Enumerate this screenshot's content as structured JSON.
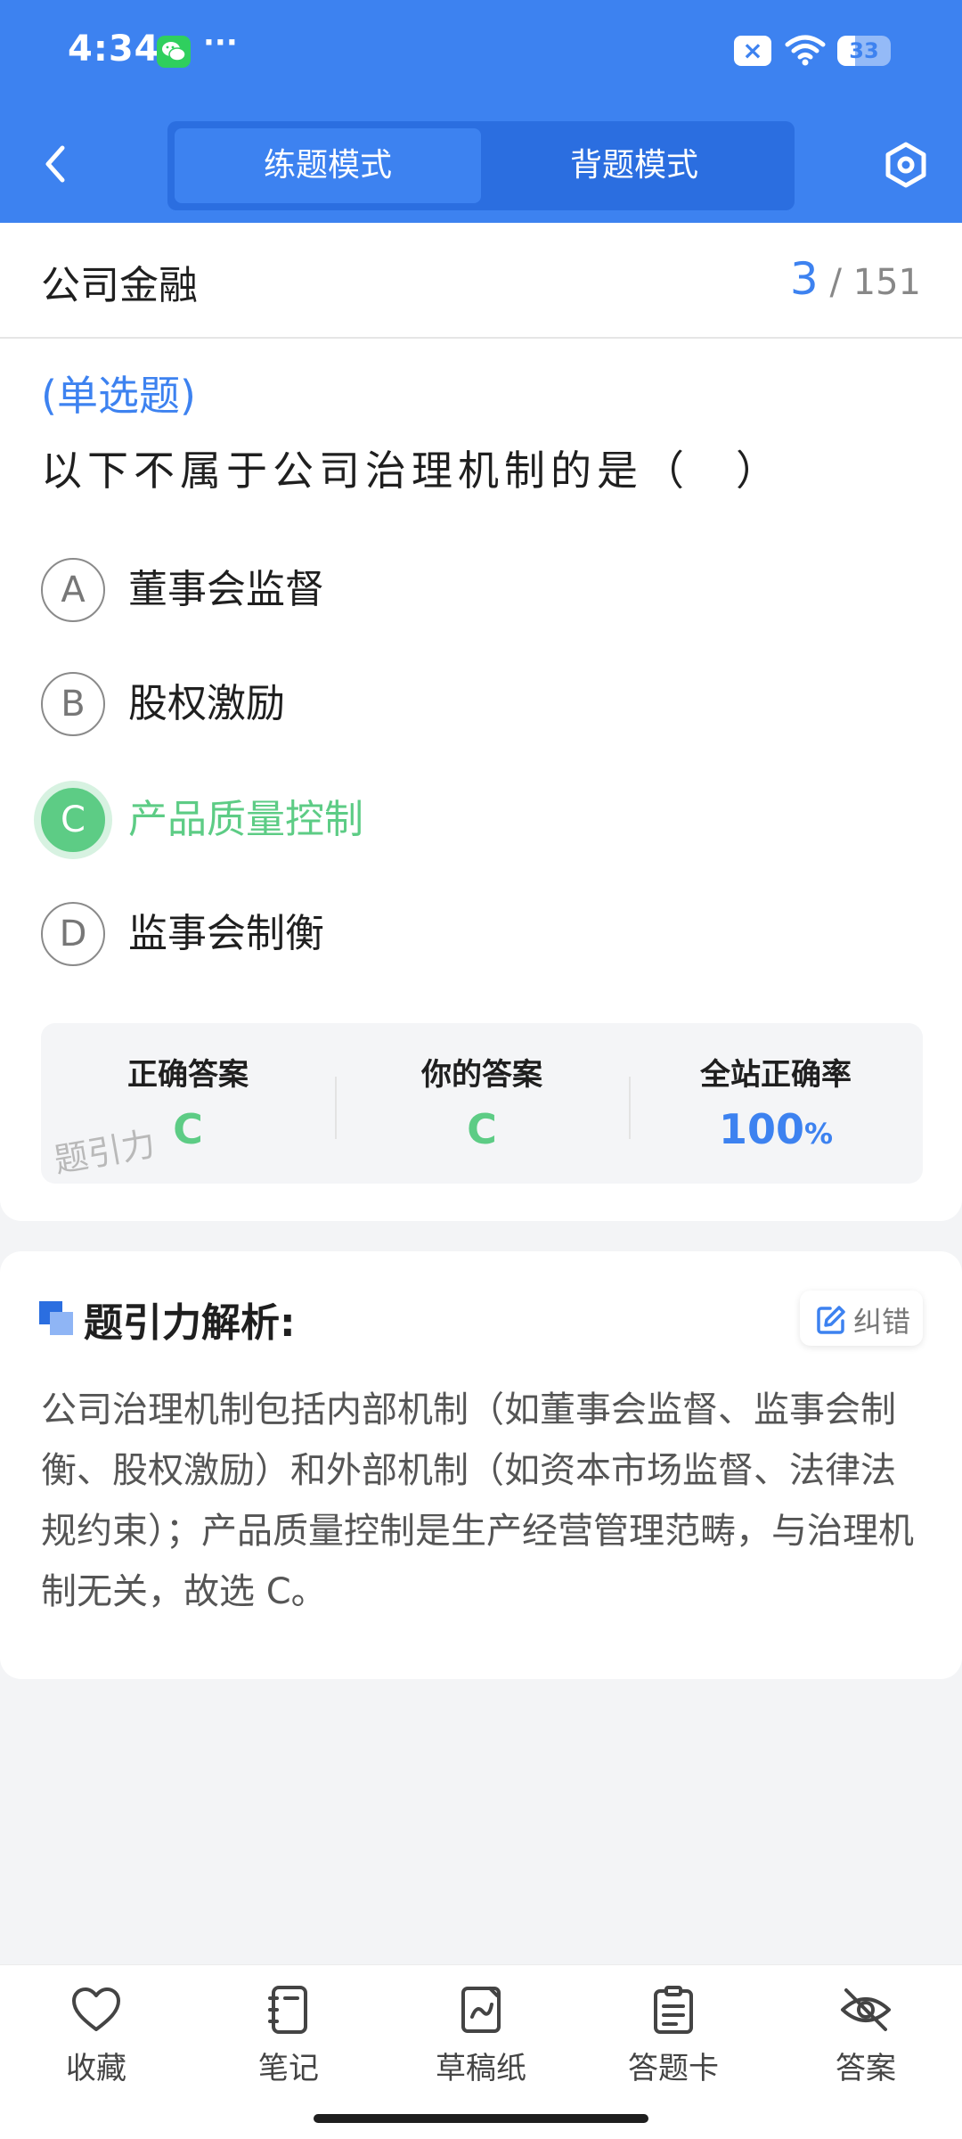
{
  "status_bar": {
    "time": "4:34",
    "dots": "···",
    "notif_badge": "×",
    "battery": "33",
    "battery_level": 0.33
  },
  "header": {
    "tabs": [
      {
        "label": "练题模式",
        "active": true
      },
      {
        "label": "背题模式",
        "active": false
      }
    ],
    "icons": {
      "back": "chevron-left-icon",
      "settings": "hexagon-settings-icon"
    }
  },
  "question_header": {
    "subject": "公司金融",
    "current": "3",
    "separator": "/",
    "total": "151"
  },
  "question": {
    "type": "(单选题)",
    "text": "以下不属于公司治理机制的是（　）"
  },
  "options": [
    {
      "letter": "A",
      "text": "董事会监督",
      "state": "normal"
    },
    {
      "letter": "B",
      "text": "股权激励",
      "state": "normal"
    },
    {
      "letter": "C",
      "text": "产品质量控制",
      "state": "correct"
    },
    {
      "letter": "D",
      "text": "监事会制衡",
      "state": "normal"
    }
  ],
  "answer_summary": {
    "correct_label": "正确答案",
    "correct_value": "C",
    "yours_label": "你的答案",
    "yours_value": "C",
    "rate_label": "全站正确率",
    "rate_value": "100",
    "rate_unit": "%",
    "watermark": "题引力"
  },
  "analysis": {
    "title": "题引力解析:",
    "fix_label": "纠错",
    "body": "公司治理机制包括内部机制（如董事会监督、监事会制衡、股权激励）和外部机制（如资本市场监督、法律法规约束）；产品质量控制是生产经营管理范畴，与治理机制无关，故选 C。"
  },
  "bottom_nav": [
    {
      "label": "收藏",
      "icon": "heart-icon"
    },
    {
      "label": "笔记",
      "icon": "notebook-icon"
    },
    {
      "label": "草稿纸",
      "icon": "draft-paper-icon"
    },
    {
      "label": "答题卡",
      "icon": "answer-card-icon"
    },
    {
      "label": "答案",
      "icon": "eye-off-icon"
    }
  ],
  "colors": {
    "primary": "#3d82f0",
    "correct": "#5dcc85",
    "background": "#f3f4f6"
  }
}
